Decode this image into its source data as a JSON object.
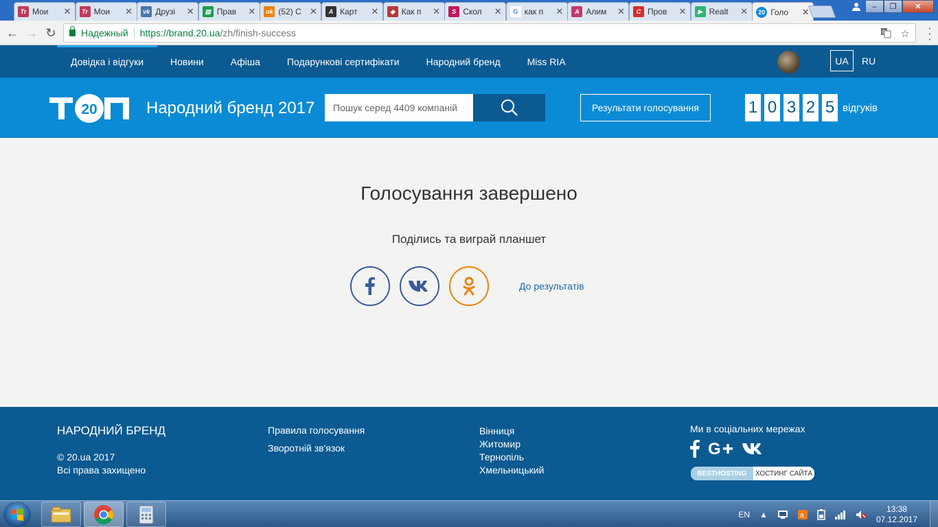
{
  "browser": {
    "tabs": [
      {
        "title": "Мои",
        "fav_color": "#c0395a",
        "fav_text": "Tr"
      },
      {
        "title": "Мои",
        "fav_color": "#c0395a",
        "fav_text": "Tr"
      },
      {
        "title": "Друзі",
        "fav_color": "#4a76a8",
        "fav_text": "vk"
      },
      {
        "title": "Прав",
        "fav_color": "#1e9e4f",
        "fav_text": "▤"
      },
      {
        "title": "(52) С",
        "fav_color": "#ee8208",
        "fav_text": "ok"
      },
      {
        "title": "Карт",
        "fav_color": "#333333",
        "fav_text": "A"
      },
      {
        "title": "Как п",
        "fav_color": "#b33a3a",
        "fav_text": "◆"
      },
      {
        "title": "Скол",
        "fav_color": "#c2185b",
        "fav_text": "S"
      },
      {
        "title": "как п",
        "fav_color": "#ffffff",
        "fav_text": "G"
      },
      {
        "title": "Алим",
        "fav_color": "#c0396b",
        "fav_text": "A"
      },
      {
        "title": "Пров",
        "fav_color": "#d32f2f",
        "fav_text": "C"
      },
      {
        "title": "Realt",
        "fav_color": "#2bb673",
        "fav_text": "▶"
      },
      {
        "title": "Голо",
        "fav_color": "#0b8bd6",
        "fav_text": "20"
      }
    ],
    "address": {
      "secure_label": "Надежный",
      "url_scheme_host": "https://brand.20.ua",
      "url_path": "/zh/finish-success"
    }
  },
  "site": {
    "nav": {
      "items": [
        "Довідка і відгуки",
        "Новини",
        "Афіша",
        "Подарункові сертифікати",
        "Народний бренд",
        "Miss RIA"
      ],
      "lang_active": "UA",
      "lang_other": "RU"
    },
    "header": {
      "title": "Народний бренд 2017",
      "search_placeholder": "Пошук серед 4409 компаній",
      "results_button": "Результати голосування",
      "counter_digits": [
        "1",
        "0",
        "3",
        "2",
        "5"
      ],
      "counter_label": "відгуків"
    },
    "main": {
      "title": "Голосування завершено",
      "subtitle": "Поділись та виграй планшет",
      "results_link": "До результатів"
    },
    "footer": {
      "brand": "НАРОДНИЙ БРЕНД",
      "copyright": "© 20.ua 2017",
      "rights": "Всі права захищено",
      "links": [
        "Правила голосування",
        "Зворотній зв'язок"
      ],
      "cities": [
        "Вінниця",
        "Житомир",
        "Тернопіль",
        "Хмельницький"
      ],
      "social_title": "Ми в соціальних мережах",
      "hosting_left": "BESTHOSTING",
      "hosting_right": "ХОСТИНГ САЙТА"
    }
  },
  "taskbar": {
    "lang": "EN",
    "time": "13:38",
    "date": "07.12.2017"
  },
  "colors": {
    "nav_bg": "#0b5a91",
    "header_bg": "#0b8bd6",
    "accent": "#2aa7e8",
    "facebook": "#3a5a99",
    "odnoklassniki": "#ee8208"
  }
}
